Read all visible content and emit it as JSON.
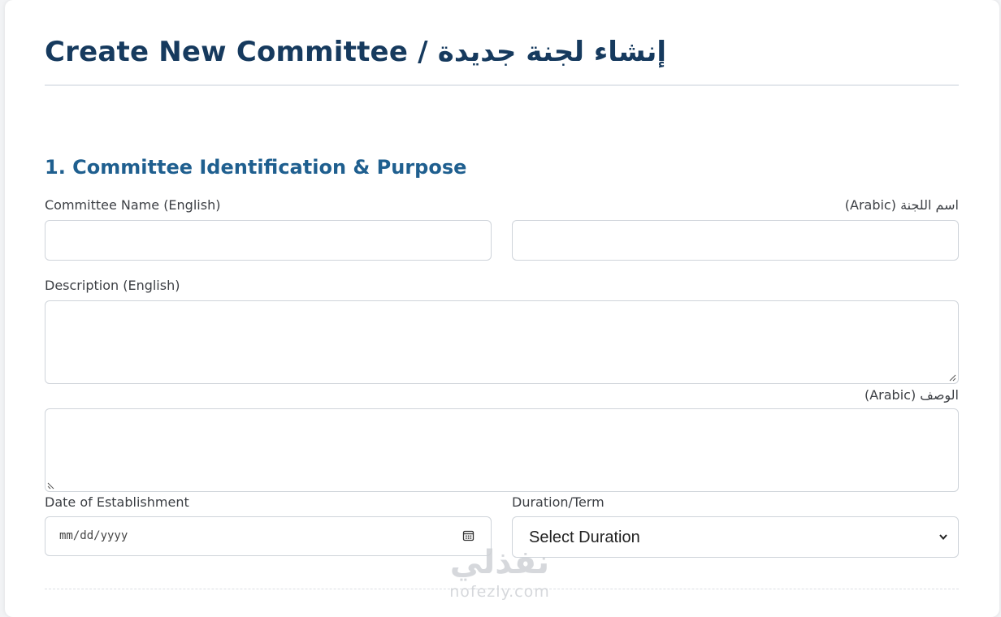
{
  "header": {
    "title": "Create New Committee / إنشاء لجنة جديدة"
  },
  "section1": {
    "title": "1. Committee Identification & Purpose",
    "name_en_label": "Committee Name (English)",
    "name_ar_label": "اسم اللجنة (Arabic)",
    "name_en_value": "",
    "name_ar_value": "",
    "desc_en_label": "Description (English)",
    "desc_ar_label": "الوصف (Arabic)",
    "desc_en_value": "",
    "desc_ar_value": "",
    "date_label": "Date of Establishment",
    "date_placeholder": "mm/dd/yyyy",
    "duration_label": "Duration/Term",
    "duration_selected": "Select Duration"
  },
  "watermark": {
    "arabic": "نفذلي",
    "latin": "nofezly.com"
  },
  "colors": {
    "title": "#163a5e",
    "section_title": "#1f5f8f",
    "input_border": "#cfd4da"
  },
  "icons": {
    "calendar": "calendar-icon",
    "dropdown": "chevron-down-icon"
  }
}
